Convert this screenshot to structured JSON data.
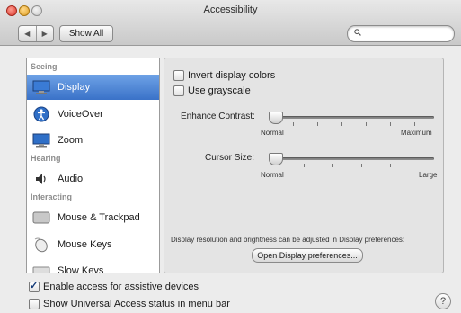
{
  "window": {
    "title": "Accessibility"
  },
  "toolbar": {
    "back": "◀",
    "forward": "▶",
    "show_all": "Show All",
    "search_placeholder": ""
  },
  "sidebar": {
    "sections": {
      "seeing": "Seeing",
      "hearing": "Hearing",
      "interacting": "Interacting"
    },
    "items": [
      {
        "label": "Display",
        "icon": "display-icon"
      },
      {
        "label": "VoiceOver",
        "icon": "voiceover-icon"
      },
      {
        "label": "Zoom",
        "icon": "zoom-icon"
      },
      {
        "label": "Audio",
        "icon": "speaker-icon"
      },
      {
        "label": "Mouse & Trackpad",
        "icon": "trackpad-icon"
      },
      {
        "label": "Mouse Keys",
        "icon": "mouse-keys-icon"
      },
      {
        "label": "Slow Keys",
        "icon": "keyboard-icon"
      }
    ],
    "selected": "Display"
  },
  "display": {
    "invert_colors": {
      "label": "Invert display colors",
      "checked": false
    },
    "grayscale": {
      "label": "Use grayscale",
      "checked": false
    },
    "contrast": {
      "label": "Enhance Contrast:",
      "min": "Normal",
      "max": "Maximum",
      "value": 0
    },
    "cursor": {
      "label": "Cursor Size:",
      "min": "Normal",
      "max": "Large",
      "value": 0
    },
    "note": "Display resolution and brightness can be adjusted in Display preferences:",
    "open_button": "Open Display preferences..."
  },
  "footer": {
    "enable_access": {
      "label": "Enable access for assistive devices",
      "checked": true
    },
    "show_status": {
      "label": "Show Universal Access status in menu bar",
      "checked": false
    },
    "help": "?"
  }
}
